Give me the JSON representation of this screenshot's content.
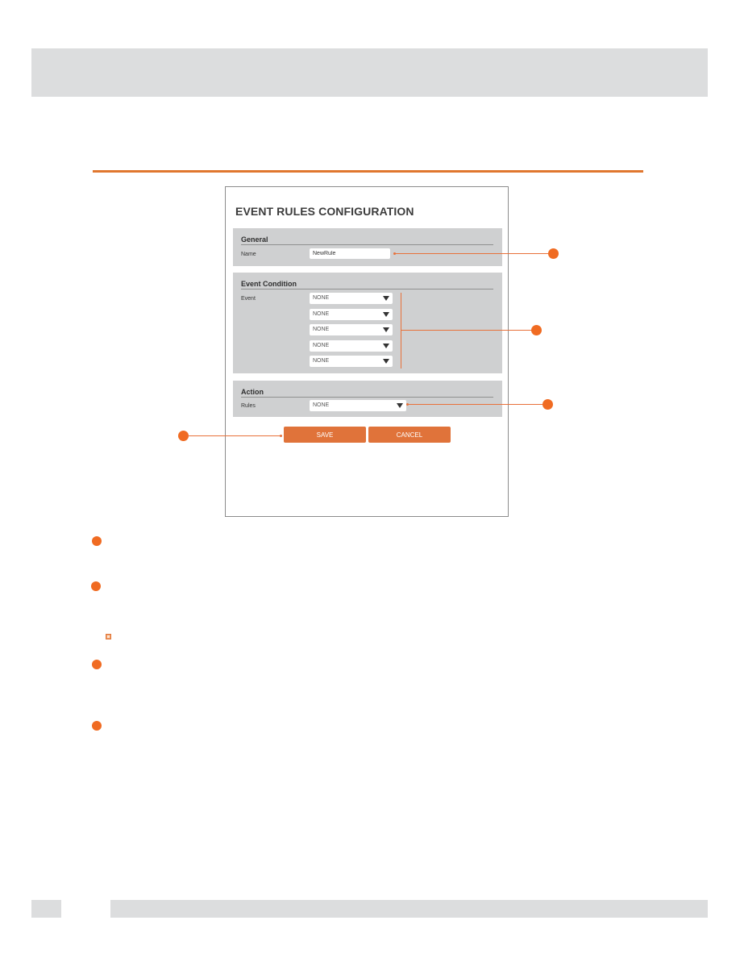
{
  "dialog": {
    "title": "EVENT RULES CONFIGURATION",
    "sections": {
      "general": {
        "heading": "General",
        "name_label": "Name",
        "name_value": "NewRule"
      },
      "event_condition": {
        "heading": "Event Condition",
        "event_label": "Event",
        "event_selects": [
          "NONE",
          "NONE",
          "NONE",
          "NONE",
          "NONE"
        ]
      },
      "action": {
        "heading": "Action",
        "rules_label": "Rules",
        "rules_value": "NONE"
      }
    },
    "buttons": {
      "save": "SAVE",
      "cancel": "CANCEL"
    }
  },
  "callouts": [
    "name-field",
    "event-condition-selects",
    "action-rules-select",
    "save-button"
  ],
  "description_list": {
    "bullet_count": 4,
    "has_note_icon": true
  },
  "colors": {
    "accent": "#e0733a",
    "callout": "#f06b22",
    "section_bg": "#cfd0d1",
    "band_gray": "#dcddde"
  }
}
